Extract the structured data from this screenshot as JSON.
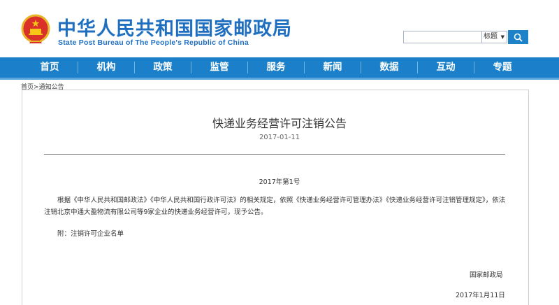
{
  "header": {
    "title_cn": "中华人民共和国国家邮政局",
    "title_en": "State Post Bureau of The People's Republic of China"
  },
  "search": {
    "value": "",
    "scope_selected": "标题"
  },
  "nav": {
    "items": [
      {
        "label": "首页"
      },
      {
        "label": "机构"
      },
      {
        "label": "政策"
      },
      {
        "label": "监管"
      },
      {
        "label": "服务"
      },
      {
        "label": "新闻"
      },
      {
        "label": "数据"
      },
      {
        "label": "互动"
      },
      {
        "label": "专题"
      }
    ]
  },
  "breadcrumb": {
    "home": "首页",
    "sep": ">",
    "current": "通知公告"
  },
  "article": {
    "title": "快递业务经营许可注销公告",
    "date": "2017-01-11",
    "doc_number": "2017年第1号",
    "body": "根据《中华人民共和国邮政法》《中华人民共和国行政许可法》的相关规定，依照《快递业务经营许可管理办法》《快递业务经营许可注销管理规定》，依法注销北京中通大盈物流有限公司等9家企业的快递业务经营许可，现予公告。",
    "attachment": "附：注销许可企业名单",
    "signature_org": "国家邮政局",
    "signature_date": "2017年1月11日"
  },
  "colors": {
    "brand_blue": "#1f6fc1",
    "nav_bg": "#1b80c9",
    "search_button": "#1e82c8"
  },
  "icons": {
    "emblem": "national-emblem-icon",
    "search": "search-icon",
    "dropdown": "chevron-down-icon"
  }
}
